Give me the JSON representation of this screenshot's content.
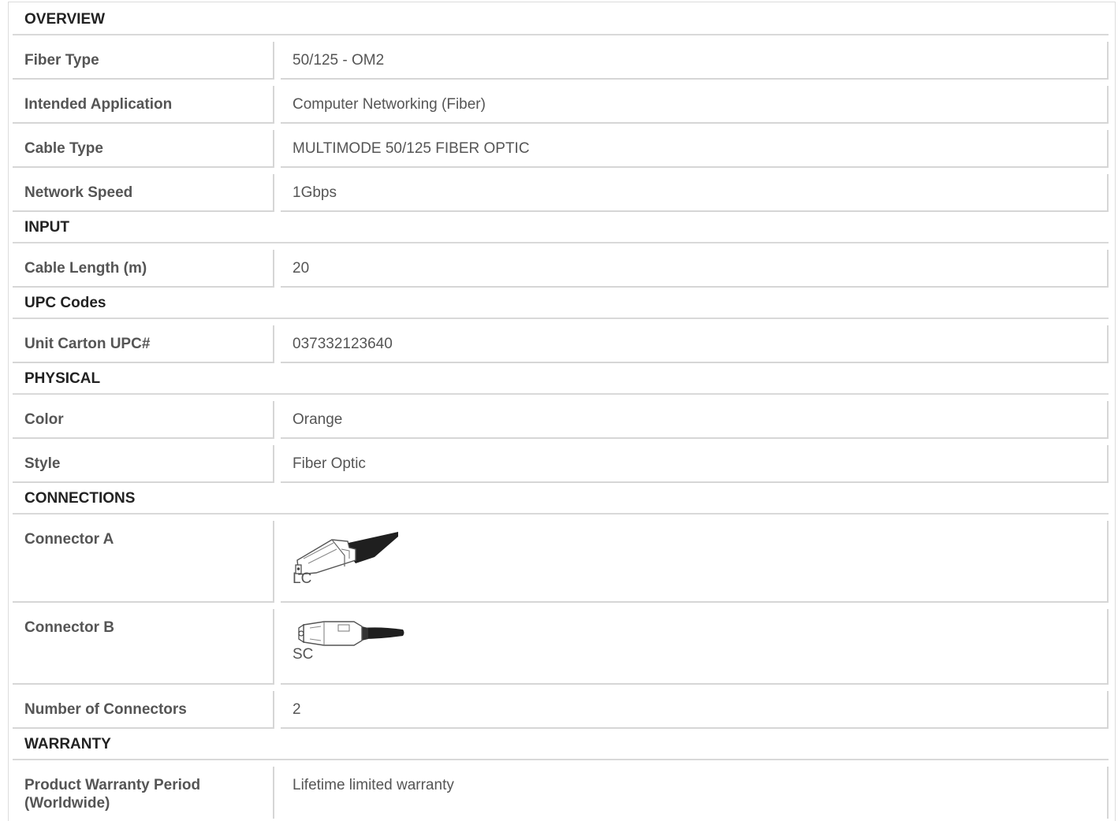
{
  "sections": {
    "overview": "OVERVIEW",
    "input": "INPUT",
    "upc": "UPC Codes",
    "physical": "PHYSICAL",
    "connections": "CONNECTIONS",
    "warranty": "WARRANTY"
  },
  "rows": {
    "fiber_type": {
      "label": "Fiber Type",
      "value": "50/125 - OM2"
    },
    "intended_application": {
      "label": "Intended Application",
      "value": "Computer Networking (Fiber)"
    },
    "cable_type": {
      "label": "Cable Type",
      "value": "MULTIMODE 50/125 FIBER OPTIC"
    },
    "network_speed": {
      "label": "Network Speed",
      "value": "1Gbps"
    },
    "cable_length": {
      "label": "Cable Length (m)",
      "value": "20"
    },
    "unit_carton_upc": {
      "label": "Unit Carton UPC#",
      "value": "037332123640"
    },
    "color": {
      "label": "Color",
      "value": "Orange"
    },
    "style": {
      "label": "Style",
      "value": "Fiber Optic"
    },
    "connector_a": {
      "label": "Connector A",
      "value": "LC",
      "icon": "lc-connector-icon"
    },
    "connector_b": {
      "label": "Connector B",
      "value": "SC",
      "icon": "sc-connector-icon"
    },
    "number_of_connectors": {
      "label": "Number of Connectors",
      "value": "2"
    },
    "warranty_period": {
      "label": "Product Warranty Period (Worldwide)",
      "value": "Lifetime limited warranty"
    }
  }
}
